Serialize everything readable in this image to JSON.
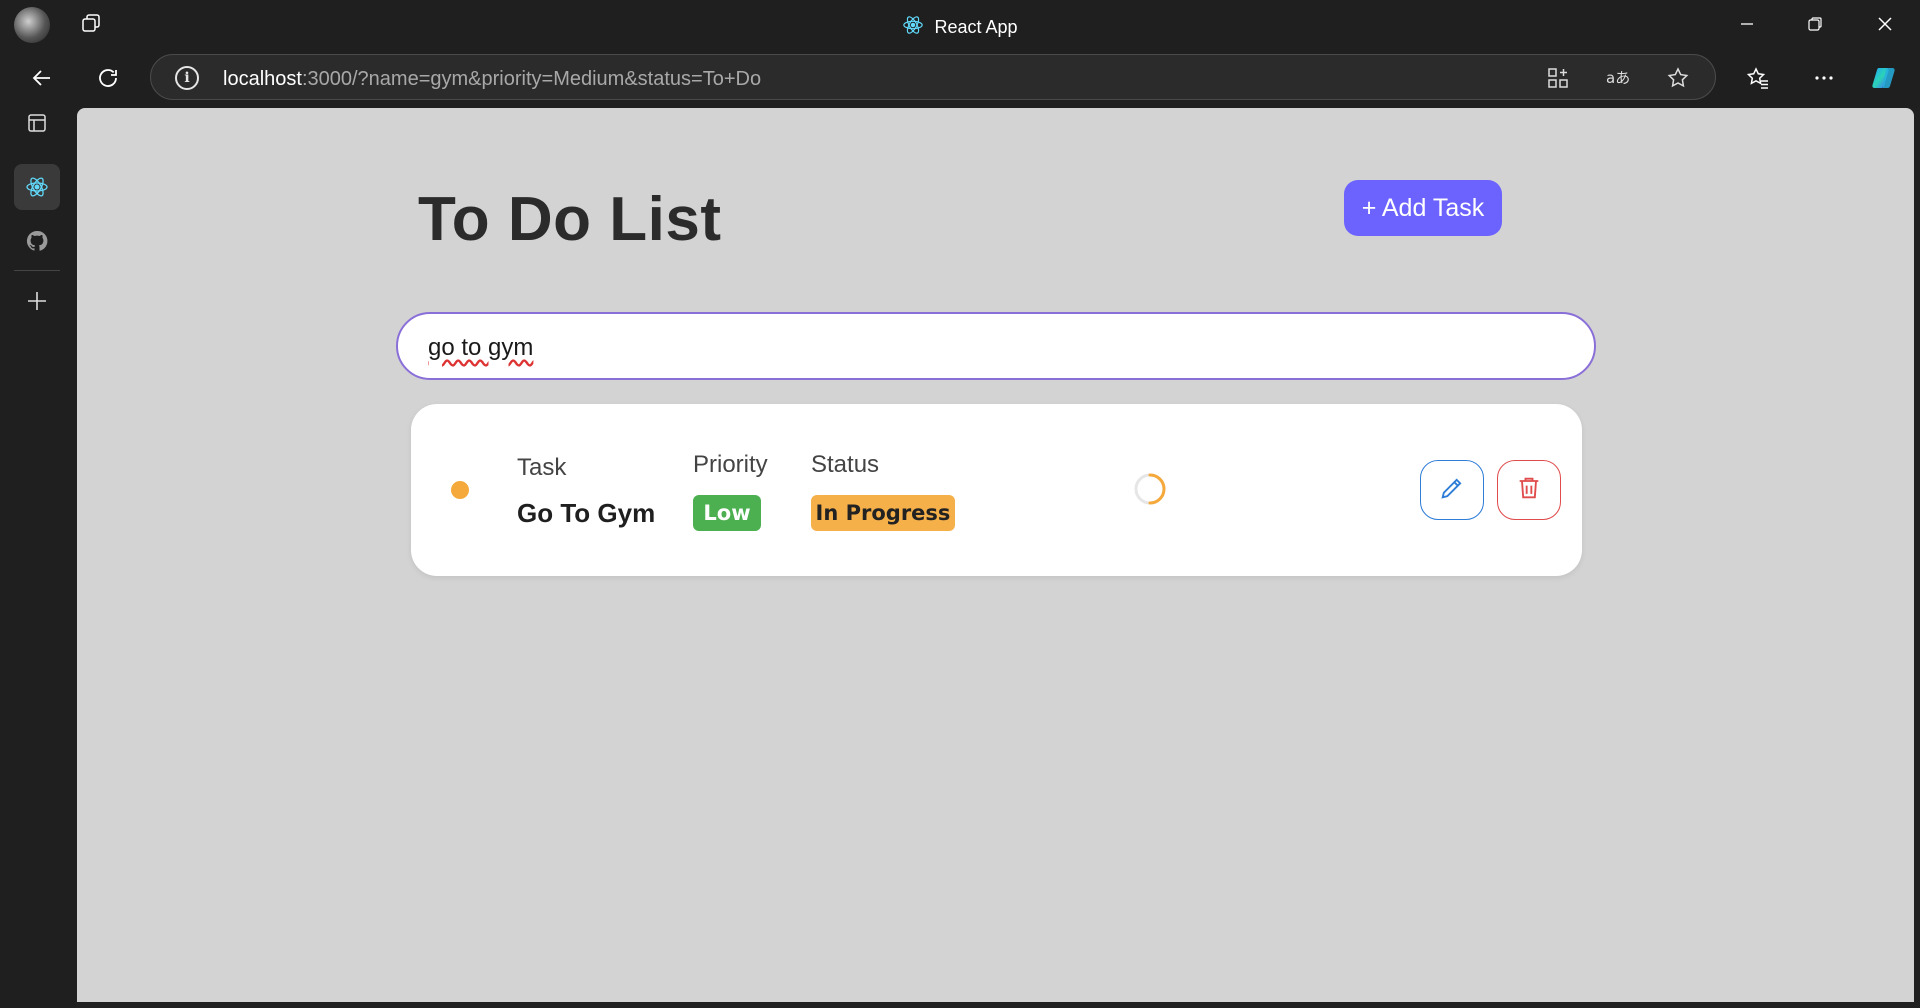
{
  "window": {
    "title": "React App"
  },
  "address_bar": {
    "host": "localhost",
    "path": ":3000/?name=gym&priority=Medium&status=To+Do"
  },
  "sidebar": {
    "items": [
      {
        "name": "tab-actions-icon"
      },
      {
        "name": "react-app-tab"
      },
      {
        "name": "github-icon"
      },
      {
        "name": "add-icon"
      }
    ]
  },
  "page": {
    "title": "To Do List",
    "add_task_label": "+ Add Task",
    "search_value": "go to gym"
  },
  "task": {
    "task_label": "Task",
    "task_name": "Go To Gym",
    "priority_label": "Priority",
    "priority_value": "Low",
    "status_label": "Status",
    "status_value": "In Progress",
    "priority_color": "#4caf50",
    "status_color": "#f5b04a",
    "dot_color": "#f5a93b"
  },
  "colors": {
    "accent": "#6c63ff",
    "edit": "#2e7dd7",
    "delete": "#e04b4b"
  }
}
